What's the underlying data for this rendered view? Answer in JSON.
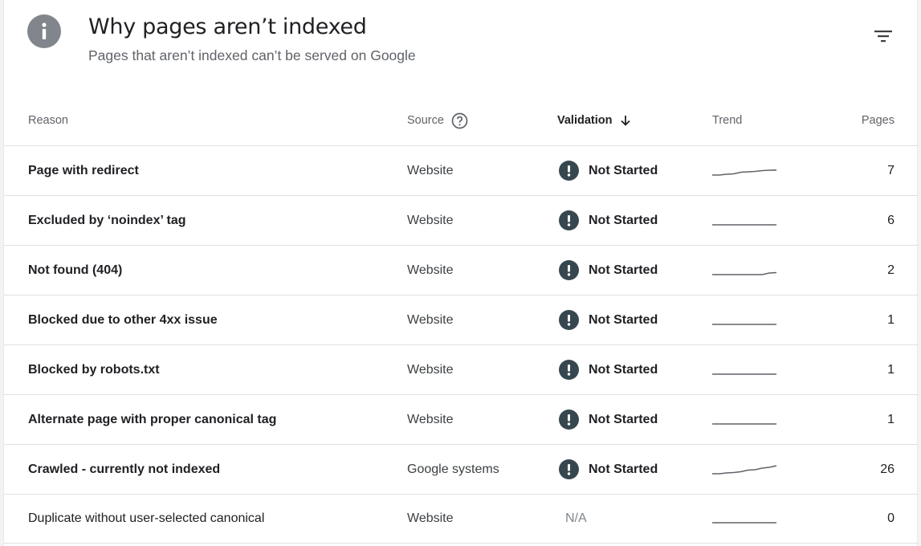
{
  "header": {
    "title": "Why pages aren’t indexed",
    "subtitle": "Pages that aren’t indexed can’t be served on Google",
    "icon": "info-icon",
    "filter_icon": "filter-icon"
  },
  "columns": {
    "reason": "Reason",
    "source": "Source",
    "validation": "Validation",
    "trend": "Trend",
    "pages": "Pages"
  },
  "colors": {
    "status_icon": "#37474f",
    "info_icon": "#80868b",
    "trend_line": "#5f6368"
  },
  "rows": [
    {
      "reason": "Page with redirect",
      "source": "Website",
      "validation": "Not Started",
      "pages": "7",
      "trend": [
        0,
        0,
        0.1,
        0.15,
        0.35,
        0.4,
        0.45,
        0.55,
        0.6,
        0.62
      ]
    },
    {
      "reason": "Excluded by ‘noindex’ tag",
      "source": "Website",
      "validation": "Not Started",
      "pages": "6",
      "trend": [
        0,
        0,
        0,
        0,
        0,
        0,
        0,
        0,
        0,
        0
      ]
    },
    {
      "reason": "Not found (404)",
      "source": "Website",
      "validation": "Not Started",
      "pages": "2",
      "trend": [
        0,
        0,
        0,
        0,
        0,
        0,
        0,
        0,
        0.2,
        0.25
      ]
    },
    {
      "reason": "Blocked due to other 4xx issue",
      "source": "Website",
      "validation": "Not Started",
      "pages": "1",
      "trend": [
        0,
        0,
        0,
        0,
        0,
        0,
        0,
        0,
        0,
        0
      ]
    },
    {
      "reason": "Blocked by robots.txt",
      "source": "Website",
      "validation": "Not Started",
      "pages": "1",
      "trend": [
        0,
        0,
        0,
        0,
        0,
        0,
        0,
        0,
        0,
        0
      ]
    },
    {
      "reason": "Alternate page with proper canonical tag",
      "source": "Website",
      "validation": "Not Started",
      "pages": "1",
      "trend": [
        0,
        0,
        0,
        0,
        0,
        0,
        0,
        0,
        0,
        0
      ]
    },
    {
      "reason": "Crawled - currently not indexed",
      "source": "Google systems",
      "validation": "Not Started",
      "pages": "26",
      "trend": [
        0,
        0,
        0.1,
        0.15,
        0.25,
        0.45,
        0.5,
        0.7,
        0.8,
        1.0
      ]
    },
    {
      "reason": "Duplicate without user-selected canonical",
      "source": "Website",
      "validation": "N/A",
      "pages": "0",
      "trend": [
        0,
        0,
        0,
        0,
        0,
        0,
        0,
        0,
        0,
        0
      ]
    }
  ]
}
